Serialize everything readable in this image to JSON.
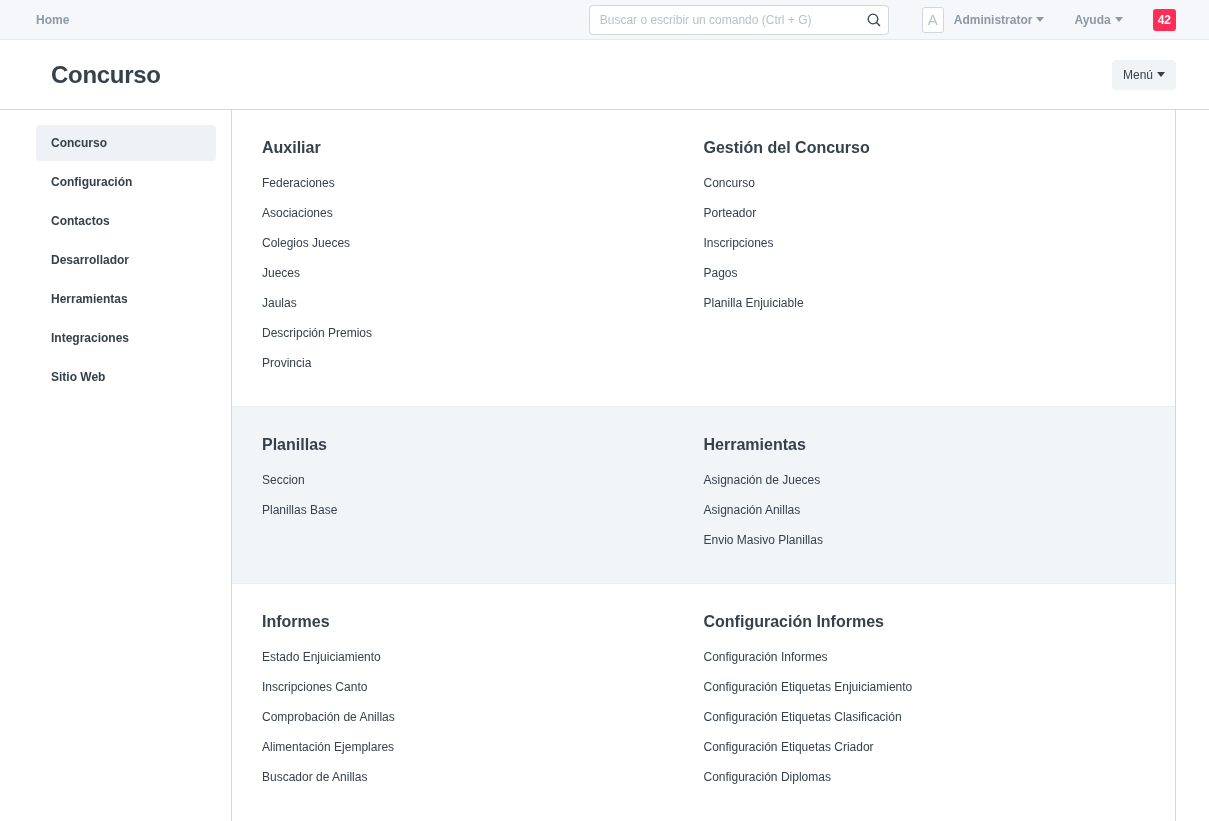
{
  "navbar": {
    "home": "Home",
    "search": {
      "placeholder": "Buscar o escribir un comando (Ctrl + G)"
    },
    "avatar": "A",
    "user": "Administrator",
    "help": "Ayuda",
    "notifications": "42"
  },
  "page": {
    "title": "Concurso",
    "menu_button": "Menú"
  },
  "sidebar": {
    "items": [
      {
        "label": "Concurso",
        "selected": true
      },
      {
        "label": "Configuración",
        "selected": false
      },
      {
        "label": "Contactos",
        "selected": false
      },
      {
        "label": "Desarrollador",
        "selected": false
      },
      {
        "label": "Herramientas",
        "selected": false
      },
      {
        "label": "Integraciones",
        "selected": false
      },
      {
        "label": "Sitio Web",
        "selected": false
      }
    ]
  },
  "rows": [
    {
      "shaded": false,
      "sections": [
        {
          "title": "Auxiliar",
          "links": [
            "Federaciones",
            "Asociaciones",
            "Colegios Jueces",
            "Jueces",
            "Jaulas",
            "Descripción Premios",
            "Provincia"
          ]
        },
        {
          "title": "Gestión del Concurso",
          "links": [
            "Concurso",
            "Porteador",
            "Inscripciones",
            "Pagos",
            "Planilla Enjuiciable"
          ]
        }
      ]
    },
    {
      "shaded": true,
      "sections": [
        {
          "title": "Planillas",
          "links": [
            "Seccion",
            "Planillas Base"
          ]
        },
        {
          "title": "Herramientas",
          "links": [
            "Asignación de Jueces",
            "Asignación Anillas",
            "Envio Masivo Planillas"
          ]
        }
      ]
    },
    {
      "shaded": false,
      "sections": [
        {
          "title": "Informes",
          "links": [
            "Estado Enjuiciamiento",
            "Inscripciones Canto",
            "Comprobación de Anillas",
            "Alimentación Ejemplares",
            "Buscador de Anillas"
          ]
        },
        {
          "title": "Configuración Informes",
          "links": [
            "Configuración Informes",
            "Configuración Etiquetas Enjuiciamiento",
            "Configuración Etiquetas Clasificación",
            "Configuración Etiquetas Criador",
            "Configuración Diplomas"
          ]
        }
      ]
    }
  ]
}
